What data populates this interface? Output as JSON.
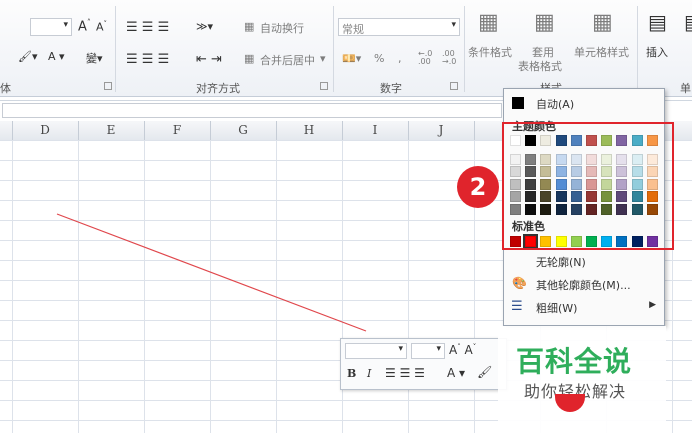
{
  "ribbon": {
    "font_group": {
      "label": "体"
    },
    "align_group": {
      "label": "对齐方式",
      "wrap_text": "自动换行",
      "merge_center": "合并后居中"
    },
    "number_group": {
      "label": "数字",
      "format_value": "常规",
      "percent": "%",
      "comma": ",",
      "inc_decimal": "←.0 .00",
      "dec_decimal": ".00 →.0"
    },
    "styles_group": {
      "label": "样式",
      "conditional": "条件格式",
      "table_fmt_top": "套用",
      "table_fmt_bottom": "表格格式",
      "cell_styles": "单元格样式"
    },
    "cells_group": {
      "insert": "插入",
      "label": "单"
    }
  },
  "columns": [
    "D",
    "E",
    "F",
    "G",
    "H",
    "I",
    "J"
  ],
  "dropdown": {
    "auto": "自动(A)",
    "theme_colors": "主题颜色",
    "standard_colors": "标准色",
    "no_outline": "无轮廓(N)",
    "more_colors": "其他轮廓颜色(M)...",
    "weight": "粗细(W)",
    "theme_palette": [
      [
        "#ffffff",
        "#000000",
        "#eeece1",
        "#1f497d",
        "#4f81bd",
        "#c0504d",
        "#9bbb59",
        "#8064a2",
        "#4bacc6",
        "#f79646"
      ],
      [
        "#f2f2f2",
        "#7f7f7f",
        "#ddd9c3",
        "#c6d9f0",
        "#dbe5f1",
        "#f2dcdb",
        "#ebf1dd",
        "#e5e0ec",
        "#dbeef3",
        "#fdeada"
      ],
      [
        "#d8d8d8",
        "#595959",
        "#c4bd97",
        "#8db3e2",
        "#b8cce4",
        "#e5b9b7",
        "#d7e3bc",
        "#ccc1d9",
        "#b7dde8",
        "#fbd5b5"
      ],
      [
        "#bfbfbf",
        "#3f3f3f",
        "#938953",
        "#548dd4",
        "#95b3d7",
        "#d99694",
        "#c3d69b",
        "#b2a2c7",
        "#92cddc",
        "#fac08f"
      ],
      [
        "#a5a5a5",
        "#262626",
        "#494429",
        "#17365d",
        "#366092",
        "#953734",
        "#76923c",
        "#5f497a",
        "#31859b",
        "#e36c09"
      ],
      [
        "#7f7f7f",
        "#0c0c0c",
        "#1d1b10",
        "#0f243e",
        "#244061",
        "#632423",
        "#4f6128",
        "#3f3151",
        "#205867",
        "#974806"
      ]
    ],
    "standard_palette": [
      "#c00000",
      "#ff0000",
      "#ffc000",
      "#ffff00",
      "#92d050",
      "#00b050",
      "#00b0f0",
      "#0070c0",
      "#002060",
      "#7030a0"
    ]
  },
  "callout_number": "2",
  "watermark": {
    "title": "百科全说",
    "subtitle": "助你轻松解决"
  },
  "colors": {
    "accent_red": "#e0242c",
    "line_red": "#e0474c",
    "brand_green": "#2fae5b"
  }
}
